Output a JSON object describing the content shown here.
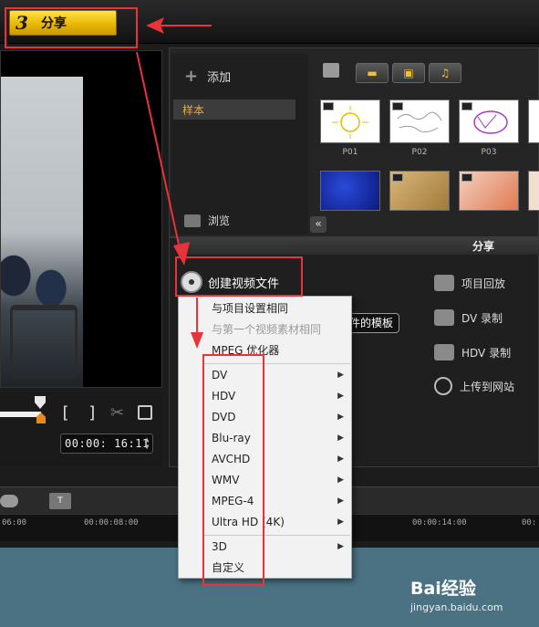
{
  "stepbar": {
    "step_number": "3",
    "step_label": "分享"
  },
  "library": {
    "add_label": "添加",
    "sample_label": "样本",
    "browse_label": "浏览",
    "thumbnails": [
      {
        "label": "P01"
      },
      {
        "label": "P02"
      },
      {
        "label": "P03"
      }
    ]
  },
  "player": {
    "mark_in": "[",
    "mark_out": "]",
    "timecode": "00:00: 16:11"
  },
  "share": {
    "title": "分享",
    "create_video": "创建视频文件",
    "template_button": "件的模板",
    "options": [
      "项目回放",
      "DV 录制",
      "HDV 录制",
      "上传到网站"
    ]
  },
  "menu": {
    "items": [
      {
        "label": "与项目设置相同",
        "disabled": false,
        "submenu": false
      },
      {
        "label": "与第一个视频素材相同",
        "disabled": true,
        "submenu": false
      },
      {
        "label": "MPEG 优化器",
        "disabled": false,
        "submenu": false
      },
      {
        "label": "DV",
        "disabled": false,
        "submenu": true
      },
      {
        "label": "HDV",
        "disabled": false,
        "submenu": true
      },
      {
        "label": "DVD",
        "disabled": false,
        "submenu": true
      },
      {
        "label": "Blu-ray",
        "disabled": false,
        "submenu": true
      },
      {
        "label": "AVCHD",
        "disabled": false,
        "submenu": true
      },
      {
        "label": "WMV",
        "disabled": false,
        "submenu": true
      },
      {
        "label": "MPEG-4",
        "disabled": false,
        "submenu": true
      },
      {
        "label": "Ultra HD (4K)",
        "disabled": false,
        "submenu": true
      },
      {
        "label": "3D",
        "disabled": false,
        "submenu": true
      },
      {
        "label": "自定义",
        "disabled": false,
        "submenu": false
      }
    ]
  },
  "timeline": {
    "title_icon": "T",
    "ticks": [
      "06:00",
      "00:00:08:00",
      "00:00:14:00",
      "00:"
    ]
  },
  "watermark": {
    "logo": "Bai经验",
    "url": "jingyan.baidu.com"
  },
  "colors": {
    "highlight_red": "#e8333a",
    "tab_yellow": "#f0c400",
    "sample_orange": "#f0a93a"
  }
}
